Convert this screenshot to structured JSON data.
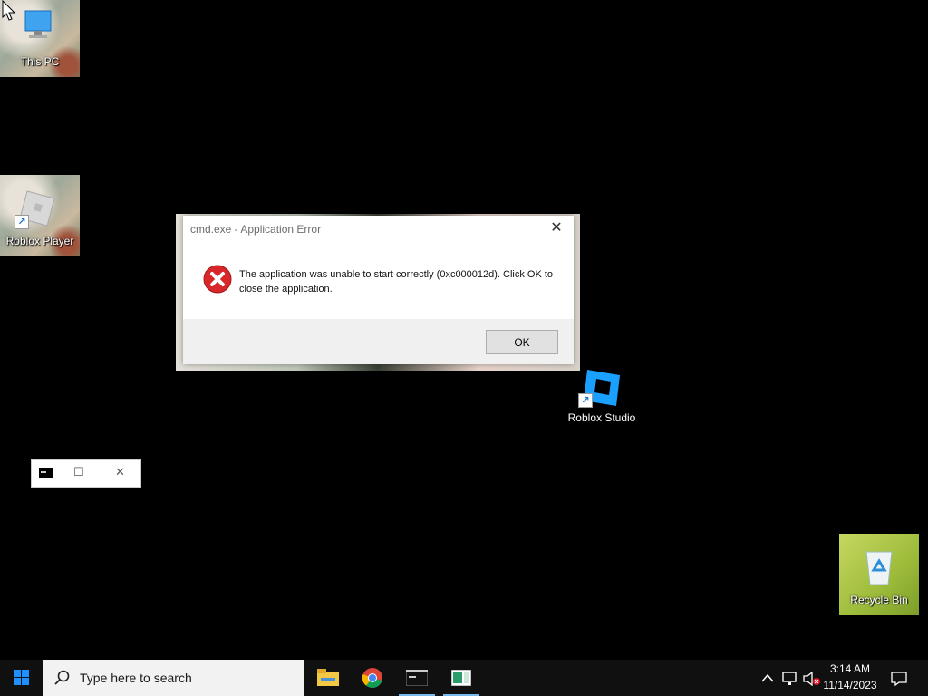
{
  "desktop": {
    "icons": [
      {
        "label": "This PC"
      },
      {
        "label": "Roblox Player"
      },
      {
        "label": "Roblox Studio"
      },
      {
        "label": "Recycle Bin"
      }
    ]
  },
  "dialog": {
    "title": "cmd.exe - Application Error",
    "message": "The application was unable to start correctly (0xc000012d). Click OK to close the application.",
    "ok_label": "OK",
    "close_glyph": "✕"
  },
  "mini_window": {
    "maximize_glyph": "☐",
    "close_glyph": "✕"
  },
  "taskbar": {
    "search_placeholder": "Type here to search",
    "time": "3:14 AM",
    "date": "11/14/2023",
    "accent": "#76b9ed"
  }
}
